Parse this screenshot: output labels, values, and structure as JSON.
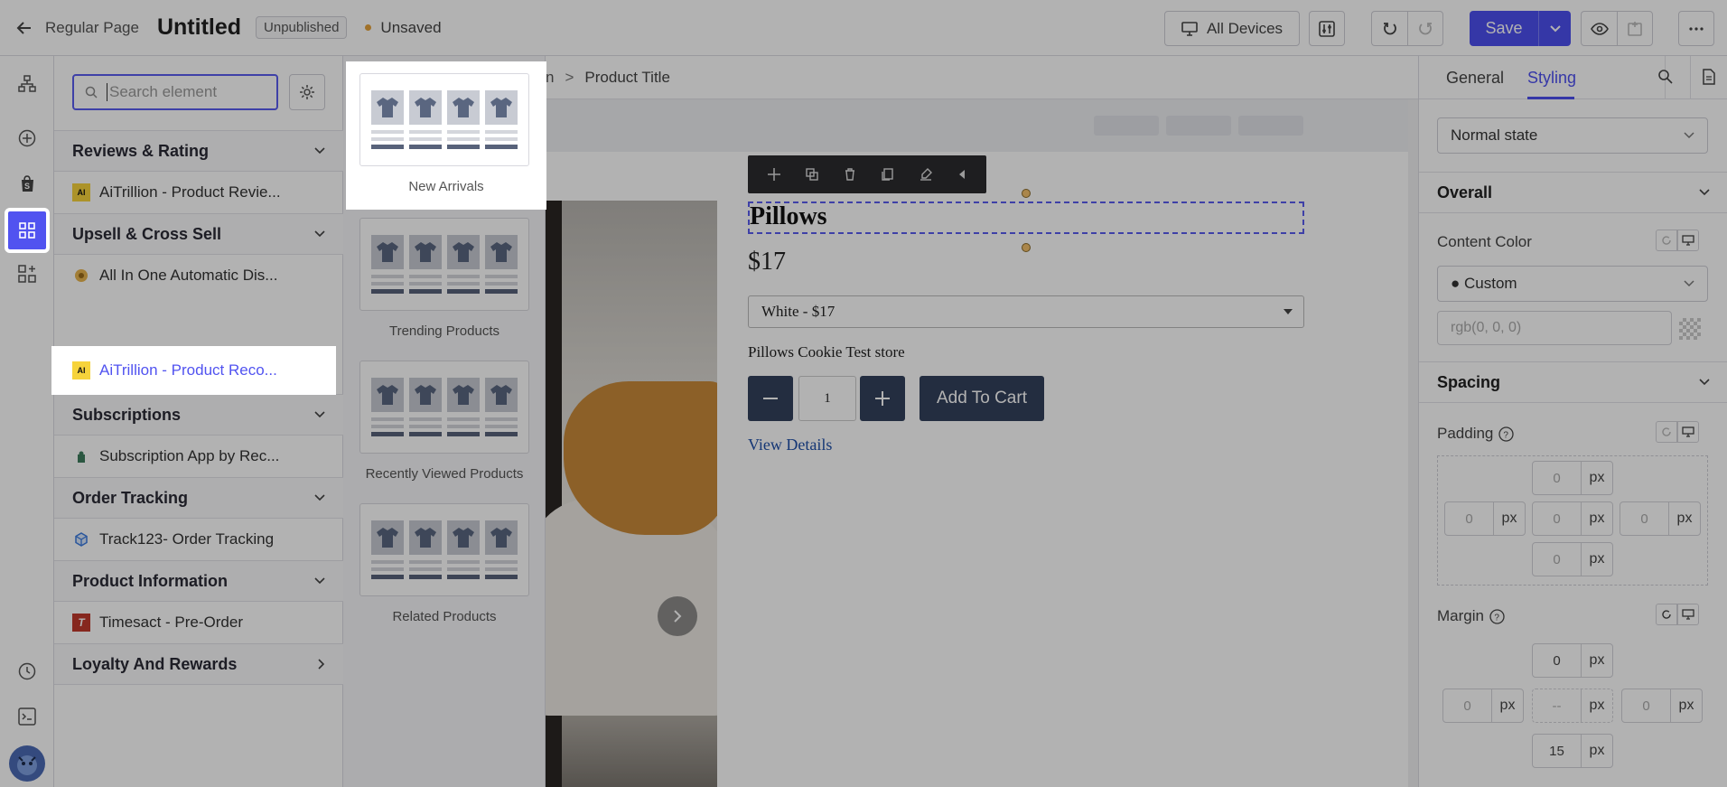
{
  "topbar": {
    "back_label": "Regular Page",
    "title": "Untitled",
    "status_badge": "Unpublished",
    "unsaved_label": "Unsaved",
    "devices_label": "All Devices",
    "save_label": "Save"
  },
  "search": {
    "placeholder": "Search element"
  },
  "categories": [
    {
      "label": "Reviews & Rating",
      "items": [
        "AiTrillion - Product Revie..."
      ]
    },
    {
      "label": "Upsell & Cross Sell",
      "items": [
        "All In One Automatic Dis...",
        "AiTrillion - Product Reco..."
      ]
    },
    {
      "label": "Subscriptions",
      "items": [
        "Subscription App by Rec..."
      ]
    },
    {
      "label": "Order Tracking",
      "items": [
        "Track123- Order Tracking"
      ]
    },
    {
      "label": "Product Information",
      "items": [
        "Timesact - Pre-Order"
      ]
    },
    {
      "label": "Loyalty And Rewards",
      "items": []
    }
  ],
  "templates": [
    "New Arrivals",
    "Trending Products",
    "Recently Viewed Products",
    "Related Products"
  ],
  "canvas": {
    "breadcrumb_prev": "n",
    "breadcrumb_current": "Product Title",
    "product_title": "Pillows",
    "price": "$17",
    "variant": "White - $17",
    "vendor": "Pillows Cookie Test store",
    "quantity": "1",
    "add_to_cart": "Add To Cart",
    "view_details": "View Details"
  },
  "right_panel": {
    "tabs": [
      "General",
      "Styling"
    ],
    "active_tab": "Styling",
    "state": "Normal state",
    "overall": "Overall",
    "content_color_label": "Content Color",
    "content_color_value": "Custom",
    "rgb_placeholder": "rgb(0, 0, 0)",
    "spacing": "Spacing",
    "padding_label": "Padding",
    "padding": {
      "top": "0",
      "left": "0",
      "center": "0",
      "right": "0",
      "bottom": "0"
    },
    "margin_label": "Margin",
    "margin": {
      "top": "0",
      "left": "0",
      "center": "--",
      "right": "0",
      "bottom": "15"
    },
    "unit": "px"
  },
  "colors": {
    "accent": "#4d4ff0",
    "button_dark": "#33415c",
    "link": "#1f4fa8"
  }
}
